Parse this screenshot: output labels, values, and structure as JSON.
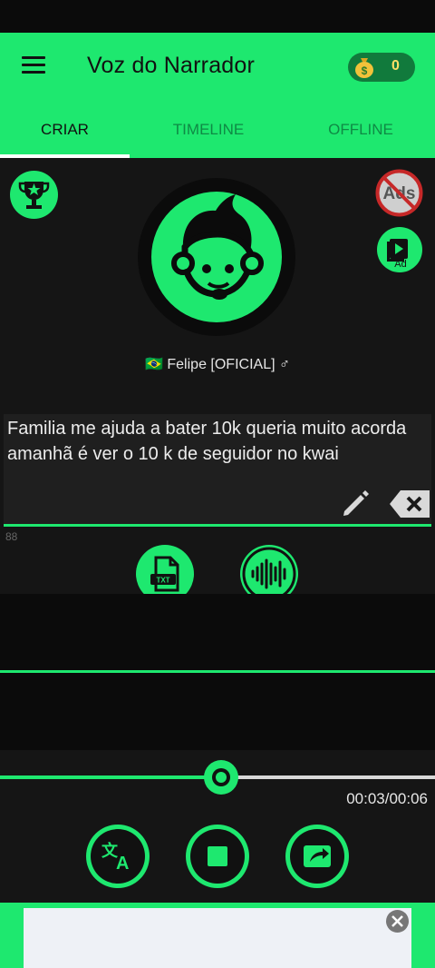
{
  "app": {
    "title": "Voz do Narrador",
    "coins": "0",
    "accent_color": "#1ee86f"
  },
  "tabs": [
    {
      "label": "CRIAR",
      "active": true
    },
    {
      "label": "TIMELINE",
      "active": false
    },
    {
      "label": "OFFLINE",
      "active": false
    }
  ],
  "header_icons": {
    "menu": "hamburger-menu-icon",
    "coins": "money-bag-icon"
  },
  "create": {
    "voice_name": "🇧🇷 Felipe [OFICIAL] ♂",
    "text_input": "Familia me ajuda a bater 10k queria muito acorda amanhã é ver o 10 k de seguidor no kwai",
    "char_count": "88",
    "icons": {
      "trophy": "trophy-icon",
      "no_ads": "no-ads-icon",
      "video_ad": "video-ad-icon",
      "avatar": "narrator-avatar-icon",
      "edit": "pencil-icon",
      "clear": "backspace-icon",
      "txt_file": "txt-file-icon",
      "audio": "audio-wave-icon"
    },
    "ads_badge": "Ads",
    "video_ad_badge": "Ad"
  },
  "player": {
    "time": "00:03/00:06",
    "progress": 0.5,
    "controls": [
      "translate-icon",
      "stop-icon",
      "share-icon"
    ]
  }
}
